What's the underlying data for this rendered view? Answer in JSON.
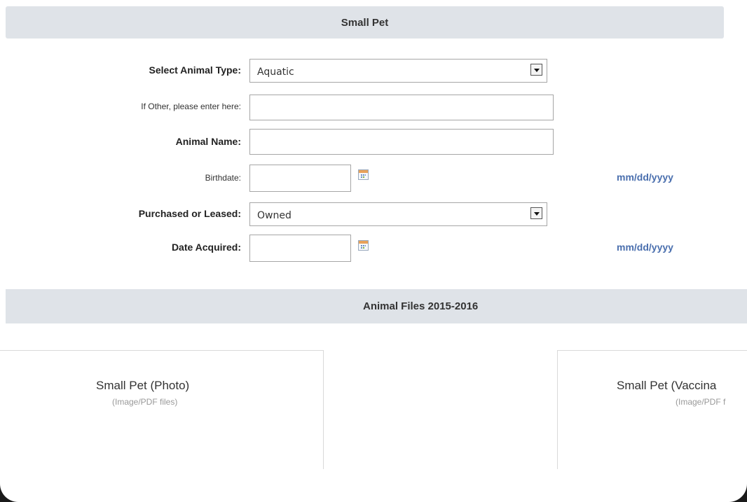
{
  "section_small_pet": {
    "title": "Small Pet"
  },
  "form": {
    "animal_type": {
      "label": "Select Animal Type:",
      "value": "Aquatic"
    },
    "other": {
      "label": "If Other, please enter here:",
      "value": ""
    },
    "animal_name": {
      "label": "Animal Name:",
      "value": ""
    },
    "birthdate": {
      "label": "Birthdate:",
      "value": "",
      "hint": "mm/dd/yyyy"
    },
    "purchased": {
      "label": "Purchased or Leased:",
      "value": "Owned"
    },
    "date_acquired": {
      "label": "Date Acquired:",
      "value": "",
      "hint": "mm/dd/yyyy"
    }
  },
  "section_files": {
    "title": "Animal Files 2015-2016"
  },
  "uploads": [
    {
      "title": "Small Pet (Photo)",
      "subtitle": "(Image/PDF files)"
    },
    {
      "title": "Small Pet (Vaccina",
      "subtitle": "(Image/PDF f"
    }
  ],
  "icons": {
    "calendar": "calendar-icon",
    "dropdown": "chevron-down-icon"
  }
}
